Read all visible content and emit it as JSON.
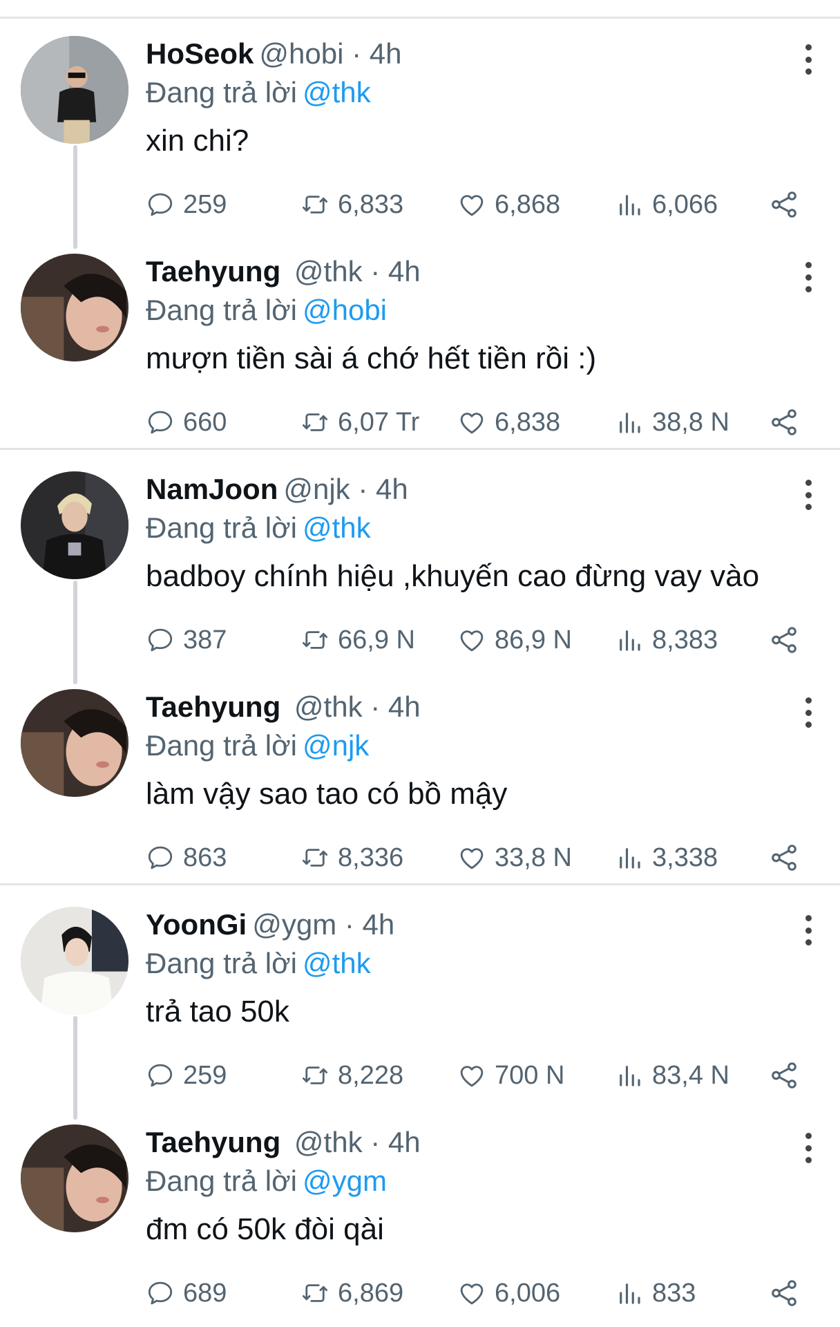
{
  "reply_prefix": "Đang trả lời",
  "time_sep": "·",
  "groups": [
    {
      "tweets": [
        {
          "name": "HoSeok",
          "handle": "@hobi",
          "time": "4h",
          "replying_to": "@thk",
          "text": "xin chi?",
          "replies": "259",
          "retweets": "6,833",
          "likes": "6,868",
          "views": "6,066"
        },
        {
          "name": "Taehyung",
          "handle": "@thk",
          "time": "4h",
          "replying_to": "@hobi",
          "text": "mượn tiền sài á chớ hết tiền rồi :)",
          "replies": "660",
          "retweets": "6,07 Tr",
          "likes": "6,838",
          "views": "38,8 N"
        }
      ]
    },
    {
      "tweets": [
        {
          "name": "NamJoon",
          "handle": "@njk",
          "time": "4h",
          "replying_to": "@thk",
          "text": "badboy chính hiệu ,khuyến cao đừng vay vào",
          "replies": "387",
          "retweets": "66,9 N",
          "likes": "86,9 N",
          "views": "8,383"
        },
        {
          "name": "Taehyung",
          "handle": "@thk",
          "time": "4h",
          "replying_to": "@njk",
          "text": "làm vậy sao tao có bồ mậy",
          "replies": "863",
          "retweets": "8,336",
          "likes": "33,8 N",
          "views": "3,338"
        }
      ]
    },
    {
      "tweets": [
        {
          "name": "YoonGi",
          "handle": "@ygm",
          "time": "4h",
          "replying_to": "@thk",
          "text": "trả tao 50k",
          "replies": "259",
          "retweets": "8,228",
          "likes": "700 N",
          "views": "83,4 N"
        },
        {
          "name": "Taehyung",
          "handle": "@thk",
          "time": "4h",
          "replying_to": "@ygm",
          "text": "đm có 50k đòi qài",
          "replies": "689",
          "retweets": "6,869",
          "likes": "6,006",
          "views": "833"
        }
      ]
    }
  ],
  "colors": {
    "accent": "#1d9bf0",
    "secondary_text": "#536471",
    "primary_text": "#0f1419",
    "thread_line": "#d0d4d8"
  },
  "icons": [
    "reply-icon",
    "retweet-icon",
    "like-icon",
    "views-icon",
    "share-icon",
    "more-icon"
  ]
}
